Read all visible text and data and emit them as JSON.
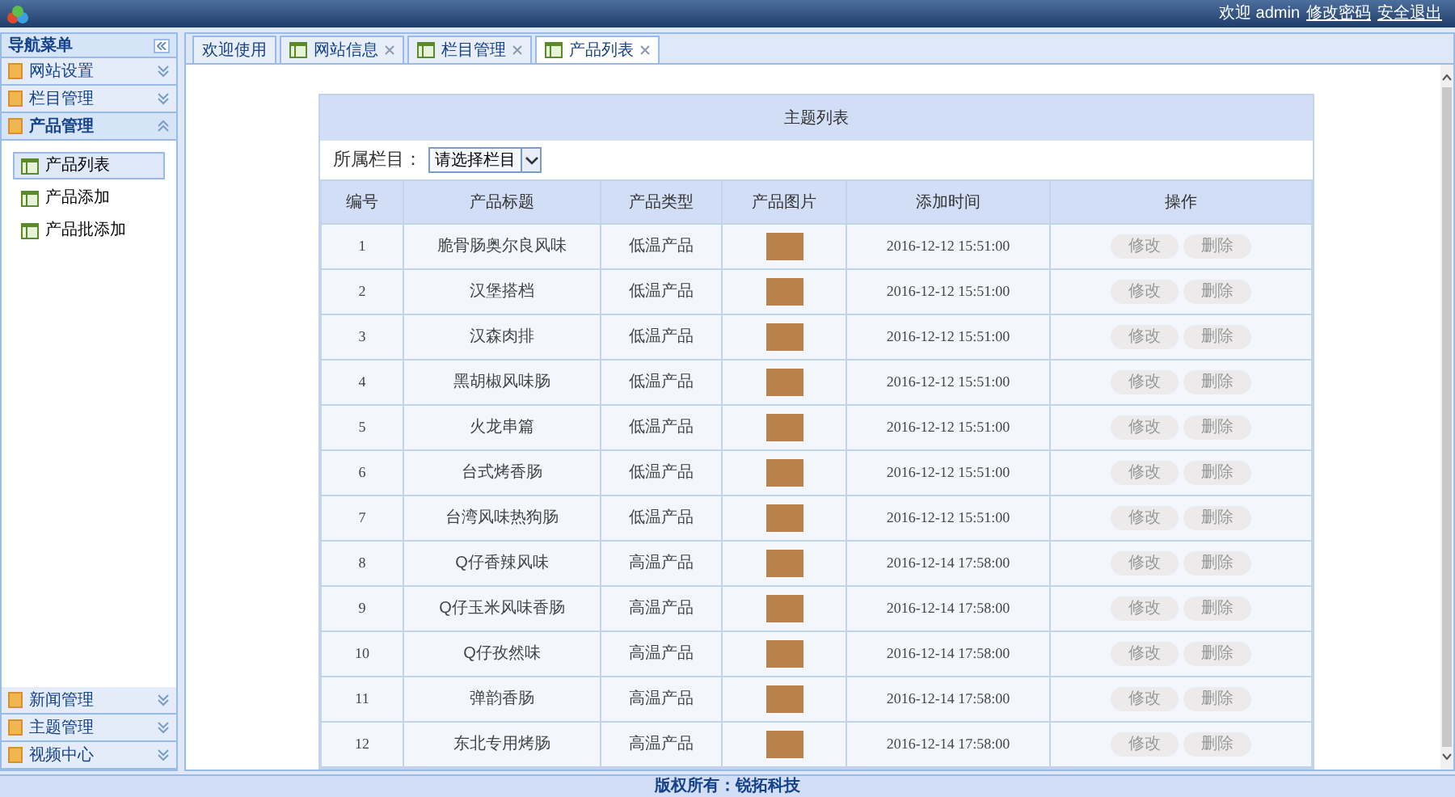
{
  "top_bar": {
    "welcome": "欢迎 admin",
    "links": [
      "修改密码",
      "安全退出"
    ]
  },
  "sidebar": {
    "title": "导航菜单",
    "sections": [
      {
        "label": "网站设置",
        "expanded": false
      },
      {
        "label": "栏目管理",
        "expanded": false
      },
      {
        "label": "产品管理",
        "expanded": true,
        "items": [
          {
            "label": "产品列表",
            "selected": true
          },
          {
            "label": "产品添加",
            "selected": false
          },
          {
            "label": "产品批添加",
            "selected": false
          }
        ]
      },
      {
        "label": "新闻管理",
        "expanded": false
      },
      {
        "label": "主题管理",
        "expanded": false
      },
      {
        "label": "视频中心",
        "expanded": false
      }
    ]
  },
  "tabs": [
    {
      "label": "欢迎使用",
      "closable": false,
      "selected": false
    },
    {
      "label": "网站信息",
      "closable": true,
      "selected": false
    },
    {
      "label": "栏目管理",
      "closable": true,
      "selected": false
    },
    {
      "label": "产品列表",
      "closable": true,
      "selected": true
    }
  ],
  "panel": {
    "title": "主题列表",
    "filter_label": "所属栏目：",
    "filter_value": "请选择栏目"
  },
  "table": {
    "columns": [
      "编号",
      "产品标题",
      "产品类型",
      "产品图片",
      "添加时间",
      "操作"
    ],
    "rows": [
      {
        "id": "1",
        "title": "脆骨肠奥尔良风味",
        "type": "低温产品",
        "time": "2016-12-12 15:51:00",
        "actions": [
          "修改",
          "删除"
        ]
      },
      {
        "id": "2",
        "title": "汉堡搭档",
        "type": "低温产品",
        "time": "2016-12-12 15:51:00",
        "actions": [
          "修改",
          "删除"
        ]
      },
      {
        "id": "3",
        "title": "汉森肉排",
        "type": "低温产品",
        "time": "2016-12-12 15:51:00",
        "actions": [
          "修改",
          "删除"
        ]
      },
      {
        "id": "4",
        "title": "黑胡椒风味肠",
        "type": "低温产品",
        "time": "2016-12-12 15:51:00",
        "actions": [
          "修改",
          "删除"
        ]
      },
      {
        "id": "5",
        "title": "火龙串篇",
        "type": "低温产品",
        "time": "2016-12-12 15:51:00",
        "actions": [
          "修改",
          "删除"
        ]
      },
      {
        "id": "6",
        "title": "台式烤香肠",
        "type": "低温产品",
        "time": "2016-12-12 15:51:00",
        "actions": [
          "修改",
          "删除"
        ]
      },
      {
        "id": "7",
        "title": "台湾风味热狗肠",
        "type": "低温产品",
        "time": "2016-12-12 15:51:00",
        "actions": [
          "修改",
          "删除"
        ]
      },
      {
        "id": "8",
        "title": "Q仔香辣风味",
        "type": "高温产品",
        "time": "2016-12-14 17:58:00",
        "actions": [
          "修改",
          "删除"
        ]
      },
      {
        "id": "9",
        "title": "Q仔玉米风味香肠",
        "type": "高温产品",
        "time": "2016-12-14 17:58:00",
        "actions": [
          "修改",
          "删除"
        ]
      },
      {
        "id": "10",
        "title": "Q仔孜然味",
        "type": "高温产品",
        "time": "2016-12-14 17:58:00",
        "actions": [
          "修改",
          "删除"
        ]
      },
      {
        "id": "11",
        "title": "弹韵香肠",
        "type": "高温产品",
        "time": "2016-12-14 17:58:00",
        "actions": [
          "修改",
          "删除"
        ]
      },
      {
        "id": "12",
        "title": "东北专用烤肠",
        "type": "高温产品",
        "time": "2016-12-14 17:58:00",
        "actions": [
          "修改",
          "删除"
        ]
      }
    ]
  },
  "footer": "版权所有：锐拓科技"
}
